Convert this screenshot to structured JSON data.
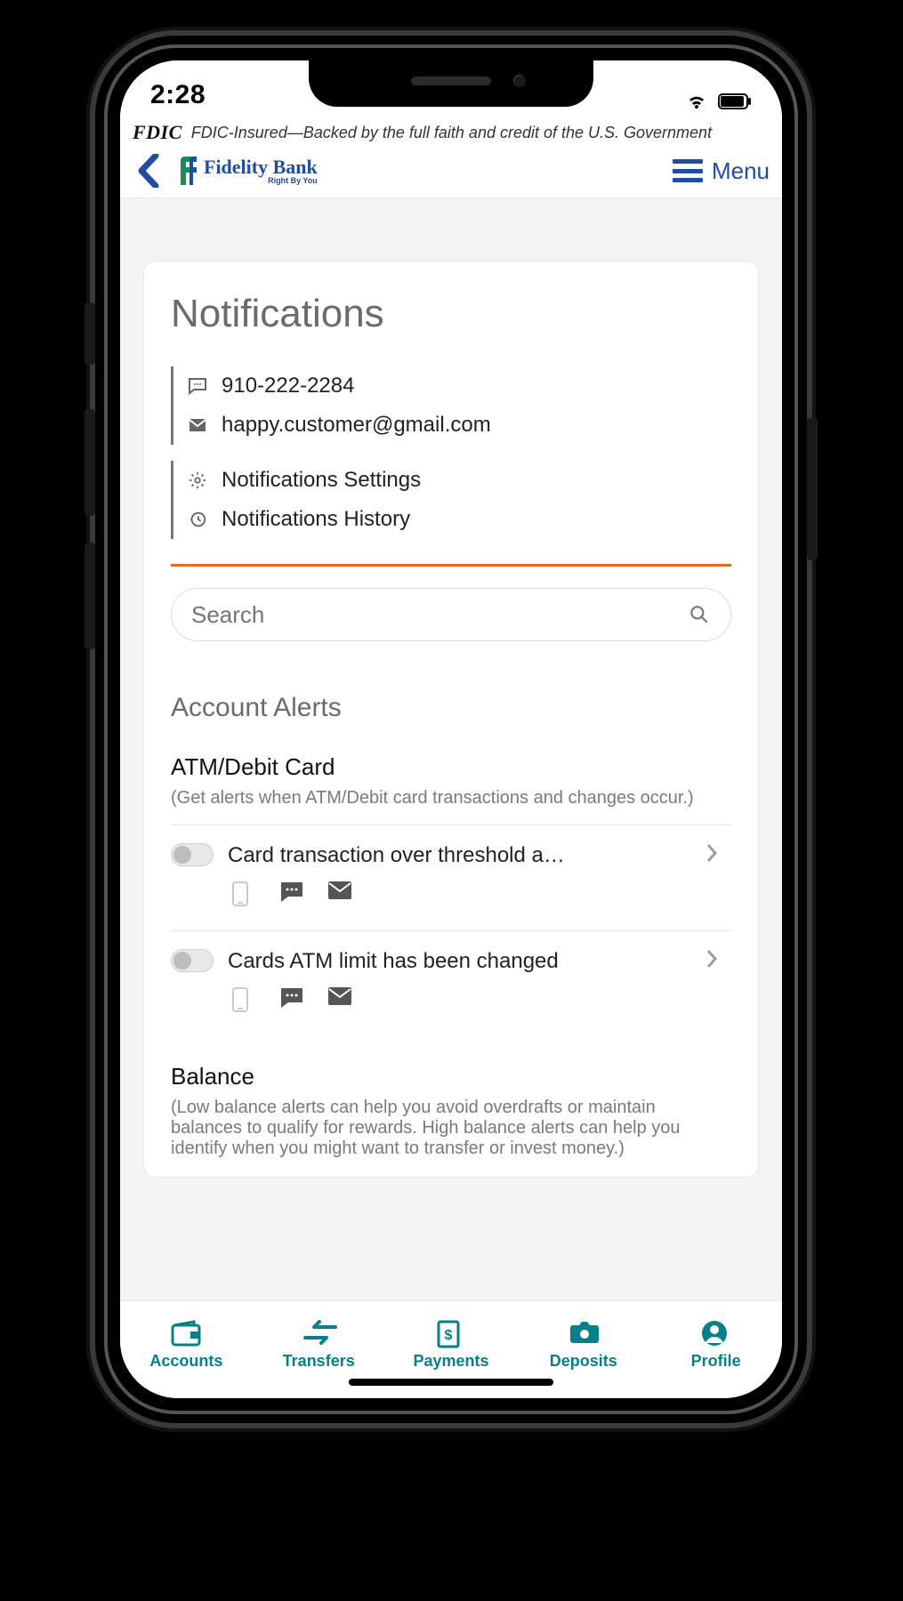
{
  "status": {
    "time": "2:28"
  },
  "fdic": {
    "badge": "FDIC",
    "text": "FDIC-Insured—Backed by the full faith and credit of the U.S. Government"
  },
  "header": {
    "brand_name": "Fidelity Bank",
    "brand_tag": "Right By You",
    "menu_label": "Menu"
  },
  "page": {
    "title": "Notifications",
    "phone": "910-222-2284",
    "email": "happy.customer@gmail.com",
    "settings_label": "Notifications Settings",
    "history_label": "Notifications History",
    "search_placeholder": "Search"
  },
  "alerts_section": {
    "heading": "Account Alerts",
    "groups": [
      {
        "name": "ATM/Debit Card",
        "desc": "(Get alerts when ATM/Debit card transactions and changes occur.)",
        "items": [
          {
            "title": "Card transaction over threshold a…"
          },
          {
            "title": "Cards ATM limit has been changed"
          }
        ]
      },
      {
        "name": "Balance",
        "desc": "(Low balance alerts can help you avoid overdrafts or maintain balances to qualify for rewards. High balance alerts can help you identify when you might want to transfer or invest money.)"
      }
    ]
  },
  "nav": {
    "items": [
      "Accounts",
      "Transfers",
      "Payments",
      "Deposits",
      "Profile"
    ]
  }
}
